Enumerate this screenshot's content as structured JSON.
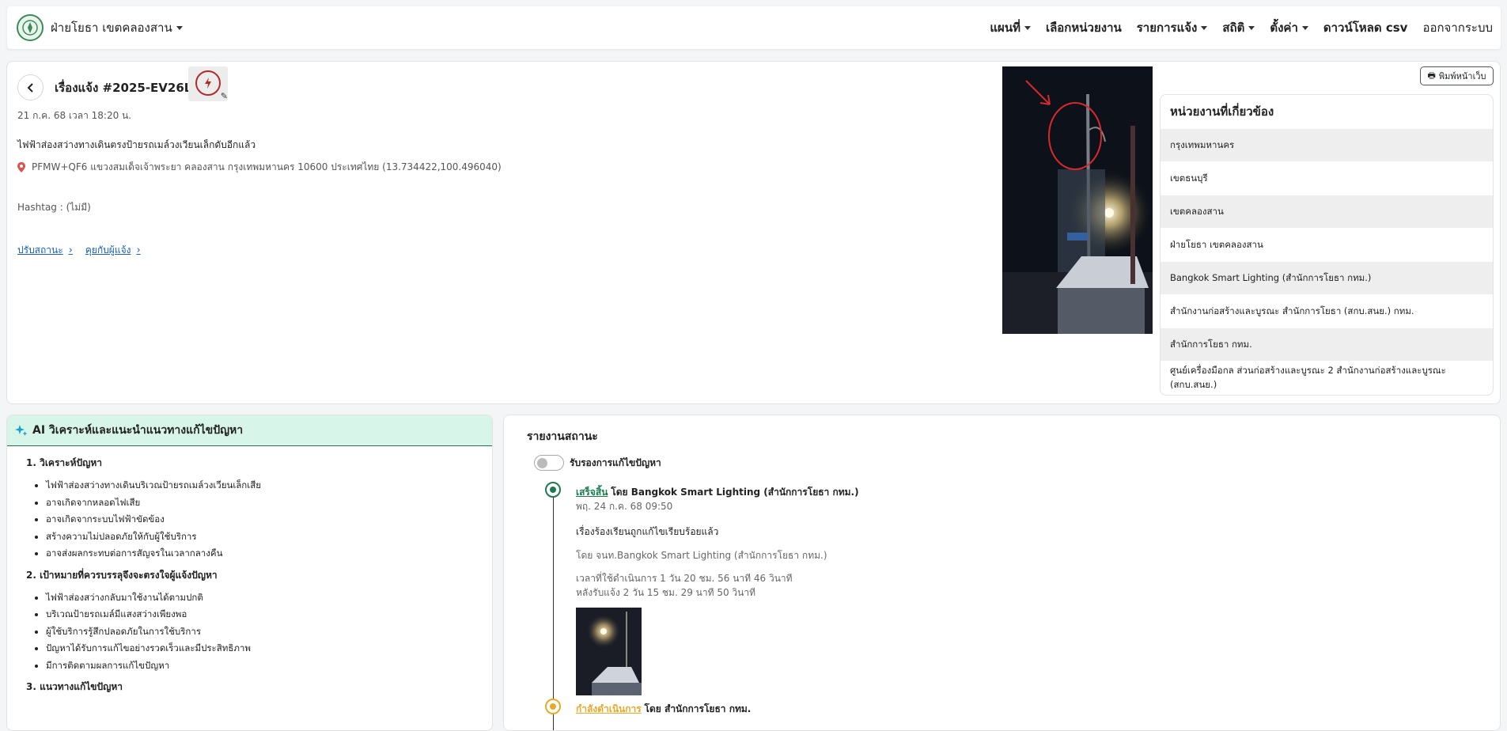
{
  "navbar": {
    "brand": "ฝ่ายโยธา เขตคลองสาน",
    "items": [
      "แผนที่",
      "เลือกหน่วยงาน",
      "รายการแจ้ง",
      "สถิติ",
      "ตั้งค่า",
      "ดาวน์โหลด csv",
      "ออกจากระบบ"
    ]
  },
  "ticket": {
    "title": "เรื่องแจ้ง #2025-EV26LT",
    "date": "21 ก.ค. 68 เวลา 18:20 น.",
    "description": "ไฟฟ้าส่องสว่างทางเดินตรงป้ายรถเมล์วงเวียนเล็กดับอีกแล้ว",
    "location": "PFMW+QF6 แขวงสมเด็จเจ้าพระยา คลองสาน กรุงเทพมหานคร 10600 ประเทศไทย (13.734422,100.496040)",
    "hashtag": "Hashtag : (ไม่มี)",
    "link_status": "ปรับสถานะ",
    "link_chat": "คุยกับผู้แจ้ง",
    "print": "พิมพ์หน้าเว็บ"
  },
  "agencies": {
    "title": "หน่วยงานที่เกี่ยวข้อง",
    "list": [
      "กรุงเทพมหานคร",
      "เขตธนบุรี",
      "เขตคลองสาน",
      "ฝ่ายโยธา เขตคลองสาน",
      "Bangkok Smart Lighting (สำนักการโยธา กทม.)",
      "สำนักงานก่อสร้างและบูรณะ สำนักการโยธา (สกบ.สนย.) กทม.",
      "สำนักการโยธา กทม.",
      "ศูนย์เครื่องมือกล ส่วนก่อสร้างและบูรณะ 2 สำนักงานก่อสร้างและบูรณะ (สกบ.สนย.)"
    ]
  },
  "ai": {
    "title": "AI วิเคราะห์และแนะนำแนวทางแก้ไขปัญหา",
    "s1": "1. วิเคราะห์ปัญหา",
    "s1_items": [
      "ไฟฟ้าส่องสว่างทางเดินบริเวณป้ายรถเมล์วงเวียนเล็กเสีย",
      "อาจเกิดจากหลอดไฟเสีย",
      "อาจเกิดจากระบบไฟฟ้าขัดข้อง",
      "สร้างความไม่ปลอดภัยให้กับผู้ใช้บริการ",
      "อาจส่งผลกระทบต่อการสัญจรในเวลากลางคืน"
    ],
    "s2": "2. เป้าหมายที่ควรบรรลุจึงจะตรงใจผู้แจ้งปัญหา",
    "s2_items": [
      "ไฟฟ้าส่องสว่างกลับมาใช้งานได้ตามปกติ",
      "บริเวณป้ายรถเมล์มีแสงสว่างเพียงพอ",
      "ผู้ใช้บริการรู้สึกปลอดภัยในการใช้บริการ",
      "ปัญหาได้รับการแก้ไขอย่างรวดเร็วและมีประสิทธิภาพ",
      "มีการติดตามผลการแก้ไขปัญหา"
    ],
    "s3": "3. แนวทางแก้ไขปัญหา"
  },
  "status": {
    "title": "รายงานสถานะ",
    "toggle_label": "รับรองการแก้ไขปัญหา",
    "e1_status": "เสร็จสิ้น",
    "e1_by": "โดย Bangkok Smart Lighting (สำนักการโยธา กทม.)",
    "e1_date": "พฤ. 24 ก.ค. 68 09:50",
    "e1_msg": "เรื่องร้องเรียนถูกแก้ไขเรียบร้อยแล้ว",
    "e1_officer": "โดย จนท.Bangkok Smart Lighting (สำนักการโยธา กทม.)",
    "e1_time1": "เวลาที่ใช้ดำเนินการ 1 วัน 20 ชม. 56 นาที 46 วินาที",
    "e1_time2": "หลังรับแจ้ง 2 วัน 15 ชม. 29 นาที 50 วินาที",
    "e2_status": "กำลังดำเนินการ",
    "e2_by": "โดย สำนักการโยธา กทม."
  },
  "colors": {
    "done": "#1e7a4f",
    "in_progress": "#e8a92a",
    "ai_header_bg": "#d8f5ea",
    "link": "#1a5fb4",
    "status_icon": "#b32a2a"
  },
  "icons": [
    "bangkok-seal-icon",
    "back-arrow-icon",
    "lightning-icon",
    "edit-icon",
    "map-pin-icon",
    "chevron-right-icon",
    "printer-icon",
    "sparkle-icon",
    "check-circle-icon"
  ]
}
